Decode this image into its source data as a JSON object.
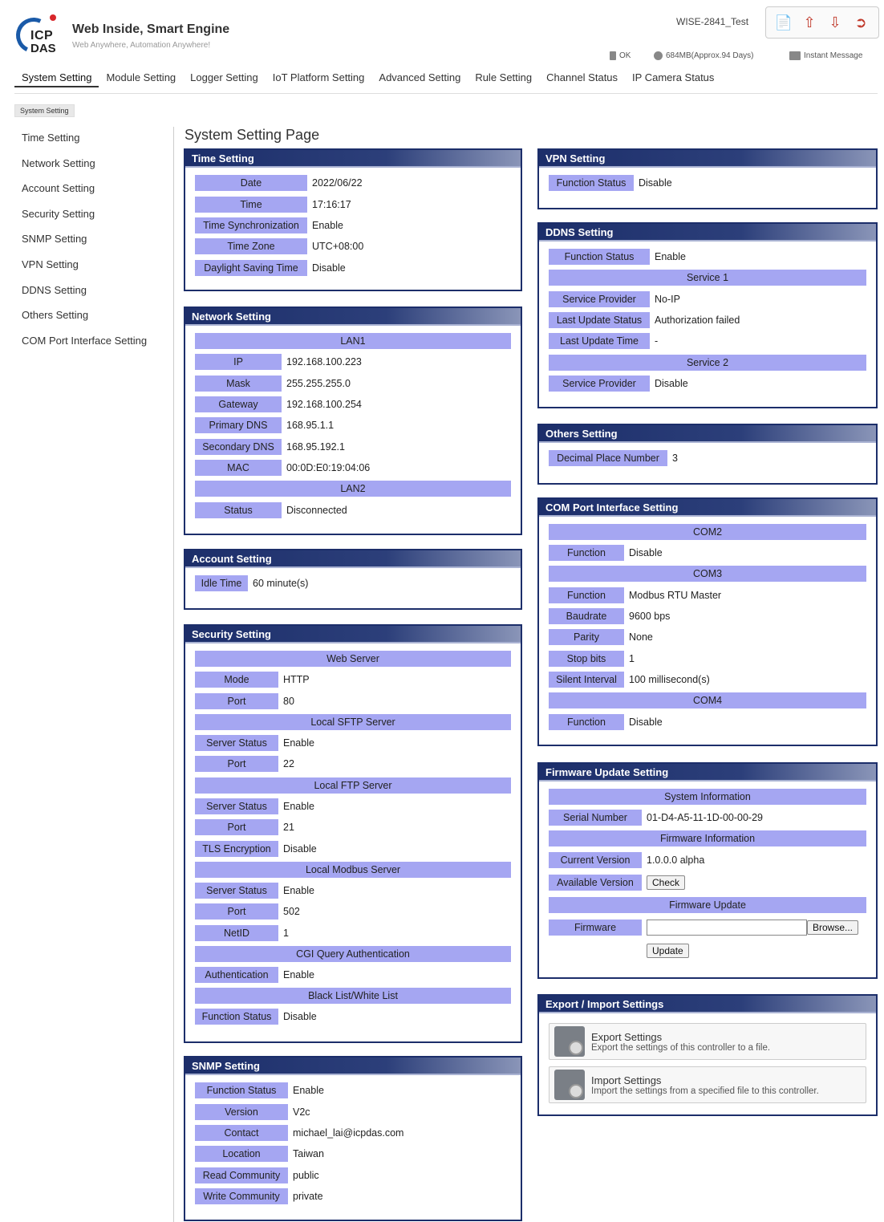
{
  "header": {
    "brand": "Web Inside, Smart Engine",
    "tagline": "Web Anywhere, Automation Anywhere!",
    "logo_text": [
      "ICP",
      "DAS"
    ],
    "device_name": "WISE-2841_Test",
    "status_ok": "OK",
    "status_storage": "684MB(Approx.94 Days)",
    "status_msg": "Instant Message"
  },
  "nav": [
    "System Setting",
    "Module Setting",
    "Logger Setting",
    "IoT Platform Setting",
    "Advanced Setting",
    "Rule Setting",
    "Channel Status",
    "IP Camera Status"
  ],
  "subtab": "System Setting",
  "sidebar": [
    "Time Setting",
    "Network Setting",
    "Account Setting",
    "Security Setting",
    "SNMP Setting",
    "VPN Setting",
    "DDNS Setting",
    "Others Setting",
    "COM Port Interface Setting"
  ],
  "page_title": "System Setting Page",
  "time": {
    "title": "Time Setting",
    "rows": [
      [
        "Date",
        "2022/06/22"
      ],
      [
        "Time",
        "17:16:17"
      ],
      [
        "Time Synchronization",
        "Enable"
      ],
      [
        "Time Zone",
        "UTC+08:00"
      ],
      [
        "Daylight Saving Time",
        "Disable"
      ]
    ]
  },
  "network": {
    "title": "Network Setting",
    "lan1": "LAN1",
    "rows": [
      [
        "IP",
        "192.168.100.223"
      ],
      [
        "Mask",
        "255.255.255.0"
      ],
      [
        "Gateway",
        "192.168.100.254"
      ],
      [
        "Primary DNS",
        "168.95.1.1"
      ],
      [
        "Secondary DNS",
        "168.95.192.1"
      ],
      [
        "MAC",
        "00:0D:E0:19:04:06"
      ]
    ],
    "lan2": "LAN2",
    "status": [
      "Status",
      "Disconnected"
    ]
  },
  "account": {
    "title": "Account Setting",
    "idle_label": "Idle Time",
    "idle_value": "60 minute(s)"
  },
  "security": {
    "title": "Security Setting",
    "web": "Web Server",
    "mode": [
      "Mode",
      "HTTP"
    ],
    "port": [
      "Port",
      "80"
    ],
    "sftp": "Local SFTP Server",
    "sftp_status": [
      "Server Status",
      "Enable"
    ],
    "sftp_port": [
      "Port",
      "22"
    ],
    "ftp": "Local FTP Server",
    "ftp_status": [
      "Server Status",
      "Enable"
    ],
    "ftp_port": [
      "Port",
      "21"
    ],
    "tls": [
      "TLS Encryption",
      "Disable"
    ],
    "modbus": "Local Modbus Server",
    "mb_status": [
      "Server Status",
      "Enable"
    ],
    "mb_port": [
      "Port",
      "502"
    ],
    "netid": [
      "NetID",
      "1"
    ],
    "cgi": "CGI Query Authentication",
    "auth": [
      "Authentication",
      "Enable"
    ],
    "bw": "Black List/White List",
    "fs": [
      "Function Status",
      "Disable"
    ]
  },
  "snmp": {
    "title": "SNMP Setting",
    "rows": [
      [
        "Function Status",
        "Enable"
      ],
      [
        "Version",
        "V2c"
      ],
      [
        "Contact",
        "michael_lai@icpdas.com"
      ],
      [
        "Location",
        "Taiwan"
      ],
      [
        "Read Community",
        "public"
      ],
      [
        "Write Community",
        "private"
      ]
    ]
  },
  "vpn": {
    "title": "VPN Setting",
    "label": "Function Status",
    "value": "Disable"
  },
  "ddns": {
    "title": "DDNS Setting",
    "fs": [
      "Function Status",
      "Enable"
    ],
    "s1": "Service 1",
    "sp1": [
      "Service Provider",
      "No-IP"
    ],
    "lus": [
      "Last Update Status",
      "Authorization failed"
    ],
    "lut": [
      "Last Update Time",
      "-"
    ],
    "s2": "Service 2",
    "sp2": [
      "Service Provider",
      "Disable"
    ]
  },
  "others": {
    "title": "Others Setting",
    "label": "Decimal Place Number",
    "value": "3"
  },
  "com": {
    "title": "COM Port Interface Setting",
    "com2": "COM2",
    "f2": [
      "Function",
      "Disable"
    ],
    "com3": "COM3",
    "f3": [
      "Function",
      "Modbus RTU Master"
    ],
    "baud": [
      "Baudrate",
      "9600 bps"
    ],
    "parity": [
      "Parity",
      "None"
    ],
    "stop": [
      "Stop bits",
      "1"
    ],
    "silent": [
      "Silent Interval",
      "100 millisecond(s)"
    ],
    "com4": "COM4",
    "f4": [
      "Function",
      "Disable"
    ]
  },
  "firmware": {
    "title": "Firmware Update Setting",
    "sysinfo": "System Information",
    "serial": [
      "Serial Number",
      "01-D4-A5-11-1D-00-00-29"
    ],
    "fwinfo": "Firmware Information",
    "cur": [
      "Current Version",
      "1.0.0.0 alpha"
    ],
    "avail": "Available Version",
    "check": "Check",
    "fwup": "Firmware Update",
    "fw": "Firmware",
    "browse": "Browse...",
    "update": "Update"
  },
  "export": {
    "title": "Export / Import Settings",
    "exp_t": "Export Settings",
    "exp_s": "Export the settings of this controller to a file.",
    "imp_t": "Import Settings",
    "imp_s": "Import the settings from a specified file to this controller."
  }
}
